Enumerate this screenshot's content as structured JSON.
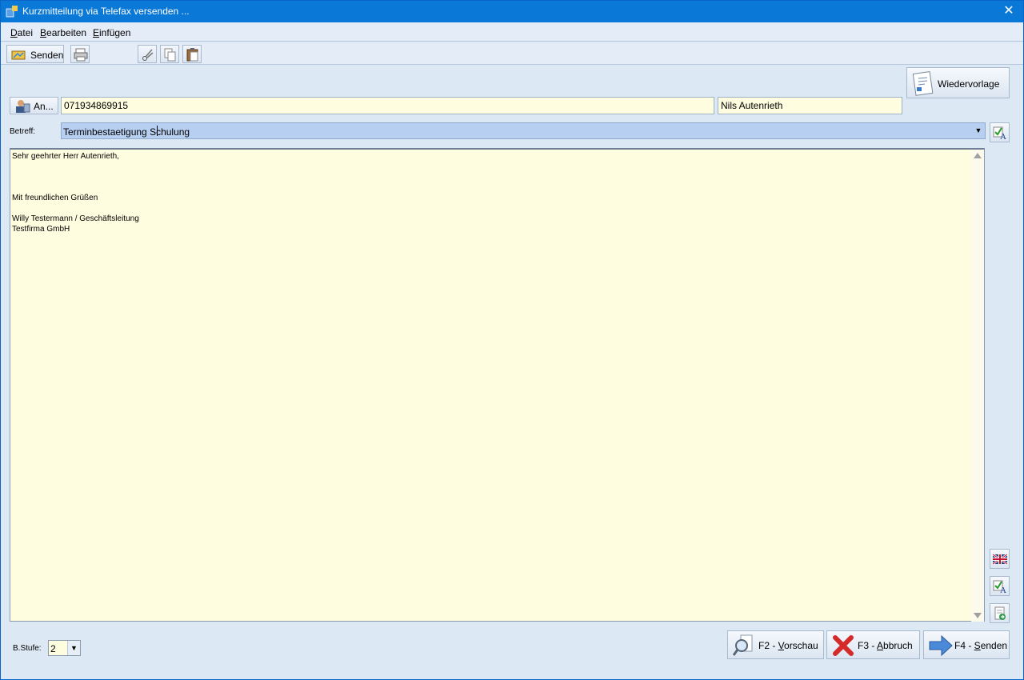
{
  "window": {
    "title": "Kurzmitteilung via Telefax versenden ...",
    "close_glyph": "✕"
  },
  "menu": [
    {
      "label": "Datei",
      "accel": "D",
      "rest": "atei"
    },
    {
      "label": "Bearbeiten",
      "accel": "B",
      "rest": "earbeiten"
    },
    {
      "label": "Einfügen",
      "accel": "E",
      "rest": "infügen"
    }
  ],
  "toolbar": {
    "send_label": "Senden",
    "icons": [
      "send-icon",
      "print-icon",
      "cut-icon",
      "copy-icon",
      "paste-icon"
    ]
  },
  "header": {
    "wiedervorlage_label": "Wiedervorlage",
    "an_label": "An..."
  },
  "recipient": {
    "fax_number": "071934869915",
    "name": "Nils Autenrieth"
  },
  "subject": {
    "label": "Betreff:",
    "value": "Terminbestaetigung Schulung",
    "arrow": "▼"
  },
  "body": {
    "text": "Sehr geehrter Herr Autenrieth,\n\n\n\nMit freundlichen Grüßen\n\nWilly Testermann / Geschäftsleitung\nTestfirma GmbH"
  },
  "bstufe": {
    "label": "B.Stufe:",
    "value": "2",
    "arrow": "▼"
  },
  "actions": {
    "preview": {
      "prefix": "F2 - ",
      "accel": "V",
      "rest": "orschau"
    },
    "abort": {
      "prefix": "F3 - ",
      "accel": "A",
      "rest": "bbruch"
    },
    "send": {
      "prefix": "F4 - ",
      "accel": "S",
      "rest": "enden"
    }
  },
  "colors": {
    "titlebar": "#0a78d7",
    "window_bg": "#dde8f5",
    "field_bg": "#fffde0",
    "subject_bg": "#b7cff0"
  }
}
